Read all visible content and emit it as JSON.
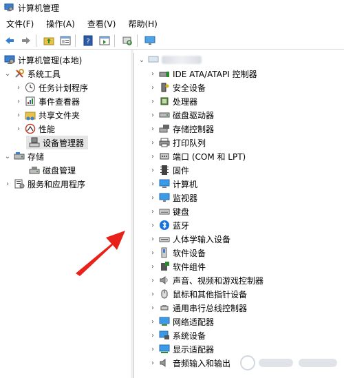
{
  "window": {
    "title": "计算机管理"
  },
  "menu": [
    "文件(F)",
    "操作(A)",
    "查看(V)",
    "帮助(H)"
  ],
  "toolbar": [
    "back-icon",
    "forward-icon",
    "up-folder-icon",
    "properties-icon",
    "help-icon",
    "show-hide-icon",
    "scan-hardware-icon",
    "monitor-icon"
  ],
  "tree": {
    "root": "计算机管理(本地)",
    "system_tools": "系统工具",
    "task_scheduler": "任务计划程序",
    "event_viewer": "事件查看器",
    "shared_folders": "共享文件夹",
    "performance": "性能",
    "device_manager": "设备管理器",
    "storage": "存储",
    "disk_management": "磁盘管理",
    "services": "服务和应用程序"
  },
  "devices": [
    "IDE ATA/ATAPI 控制器",
    "安全设备",
    "处理器",
    "磁盘驱动器",
    "存储控制器",
    "打印队列",
    "端口 (COM 和 LPT)",
    "固件",
    "计算机",
    "监视器",
    "键盘",
    "蓝牙",
    "人体学输入设备",
    "软件设备",
    "软件组件",
    "声音、视频和游戏控制器",
    "鼠标和其他指针设备",
    "通用串行总线控制器",
    "网络适配器",
    "系统设备",
    "显示适配器",
    "音频输入和输出"
  ],
  "device_icons": [
    "ide-icon",
    "security-icon",
    "cpu-icon",
    "disk-icon",
    "storage-icon",
    "printer-icon",
    "port-icon",
    "firmware-icon",
    "computer-icon",
    "monitor-icon",
    "keyboard-icon",
    "bluetooth-icon",
    "hid-icon",
    "software-device-icon",
    "software-component-icon",
    "sound-icon",
    "mouse-icon",
    "usb-icon",
    "network-icon",
    "system-icon",
    "display-icon",
    "audio-icon"
  ],
  "colors": {
    "arrow": "#e8211a",
    "bluetooth": "#1a73d9",
    "selection": "#e5e5e5"
  }
}
